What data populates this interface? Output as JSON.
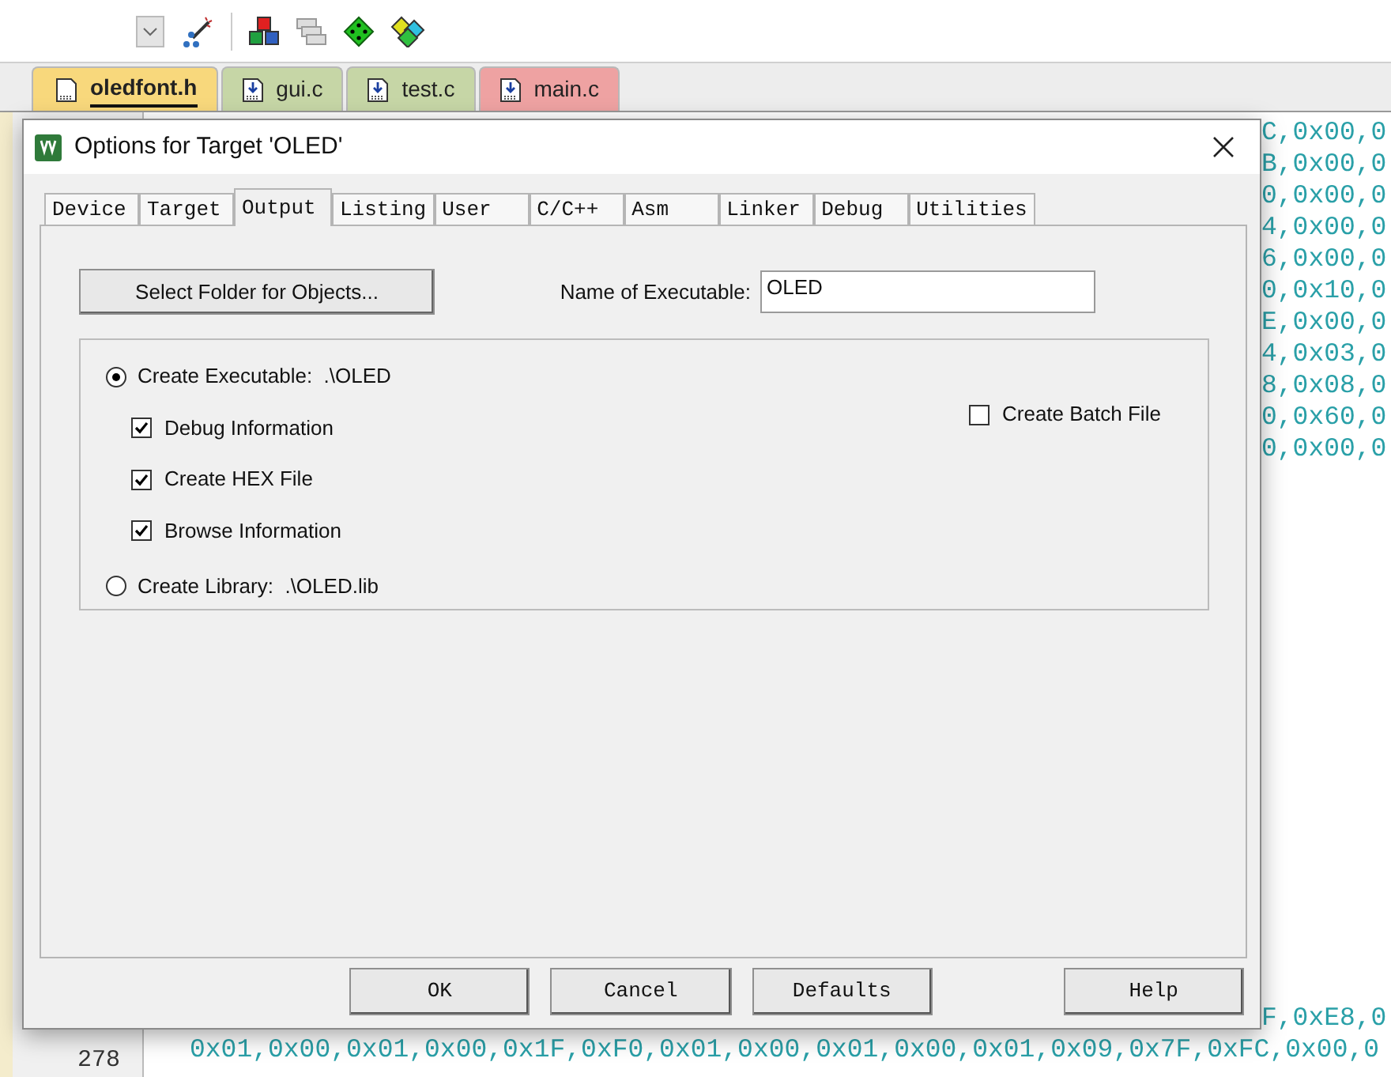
{
  "file_tabs": [
    {
      "label": "oledfont.h",
      "selected": true,
      "color": "#f8d87c"
    },
    {
      "label": "gui.c",
      "selected": false,
      "color": "#c6d6a6"
    },
    {
      "label": "test.c",
      "selected": false,
      "color": "#c6d6a6"
    },
    {
      "label": "main.c",
      "selected": false,
      "color": "#eea2a2"
    }
  ],
  "editor": {
    "top_lines": [
      {
        "text": "C,0x00,0"
      },
      {
        "text": "B,0x00,0"
      },
      {
        "text": "0,0x00,0"
      },
      {
        "text": "4,0x00,0"
      },
      {
        "text": "6,0x00,0"
      },
      {
        "text": "0,0x10,0"
      },
      {
        "text": "E,0x00,0"
      },
      {
        "text": "4,0x03,0"
      },
      {
        "text": "8,0x08,0"
      },
      {
        "text": "0,0x60,0"
      },
      {
        "text": "0,0x00,0"
      }
    ],
    "bottom_lines": [
      {
        "covered": true,
        "text": "F,0xE8,0"
      },
      {
        "number": "278",
        "covered": false,
        "text": "0x01,0x00,0x01,0x00,0x1F,0xF0,0x01,0x00,0x01,0x00,0x01,0x09,0x7F,0xFC,0x00,0"
      }
    ]
  },
  "dialog": {
    "title": "Options for Target 'OLED'",
    "tabs": [
      {
        "label": "Device",
        "selected": false
      },
      {
        "label": "Target",
        "selected": false
      },
      {
        "label": "Output",
        "selected": true
      },
      {
        "label": "Listing",
        "selected": false
      },
      {
        "label": "User",
        "selected": false
      },
      {
        "label": "C/C++",
        "selected": false
      },
      {
        "label": "Asm",
        "selected": false
      },
      {
        "label": "Linker",
        "selected": false
      },
      {
        "label": "Debug",
        "selected": false
      },
      {
        "label": "Utilities",
        "selected": false
      }
    ],
    "select_folder_button": "Select Folder for Objects...",
    "executable_label": "Name of Executable:",
    "executable_value": "OLED",
    "create_executable": {
      "label": "Create Executable:  .\\OLED",
      "selected": true
    },
    "options": [
      {
        "label": "Debug Information",
        "checked": true
      },
      {
        "label": "Create HEX File",
        "checked": true
      },
      {
        "label": "Browse Information",
        "checked": true
      }
    ],
    "create_library": {
      "label": "Create Library:  .\\OLED.lib",
      "selected": false
    },
    "batch_file": {
      "label": "Create Batch File",
      "checked": false
    },
    "buttons": [
      {
        "label": "OK"
      },
      {
        "label": "Cancel"
      },
      {
        "label": "Defaults"
      },
      {
        "label": "Help"
      }
    ]
  }
}
